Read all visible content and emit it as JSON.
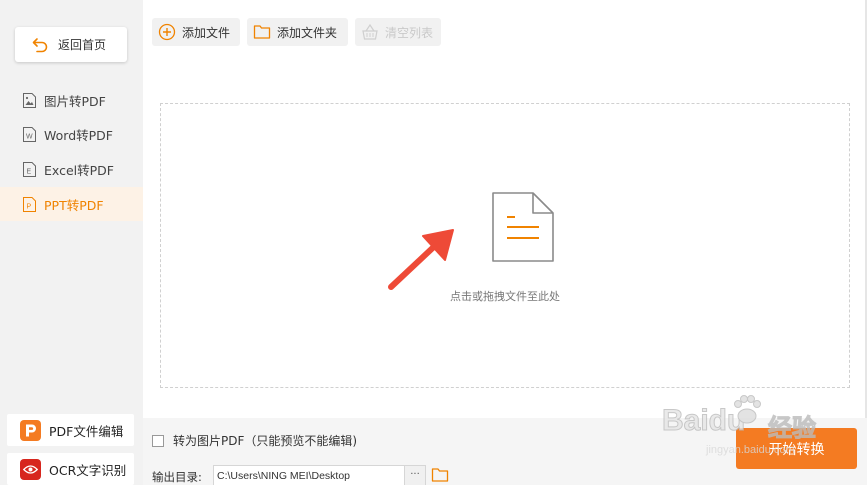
{
  "sidebar": {
    "back_label": "返回首页",
    "items": [
      {
        "label": "图片转PDF",
        "icon": "image-file-icon"
      },
      {
        "label": "Word转PDF",
        "icon": "word-file-icon"
      },
      {
        "label": "Excel转PDF",
        "icon": "excel-file-icon"
      },
      {
        "label": "PPT转PDF",
        "icon": "ppt-file-icon",
        "active": true
      }
    ],
    "tools": [
      {
        "label": "PDF文件编辑",
        "icon": "pdf-edit-icon",
        "color": "#f47b22"
      },
      {
        "label": "OCR文字识别",
        "icon": "ocr-eye-icon",
        "color": "#d7261e"
      }
    ]
  },
  "toolbar": {
    "add_file": "添加文件",
    "add_folder": "添加文件夹",
    "clear_list": "清空列表"
  },
  "dropzone": {
    "hint": "点击或拖拽文件至此处"
  },
  "bottom": {
    "to_image_pdf": "转为图片PDF（只能预览不能编辑)",
    "output_label": "输出目录:",
    "output_path": "C:\\Users\\NING MEI\\Desktop",
    "more_label": "···",
    "start_label": "开始转换"
  },
  "watermark": {
    "brand": "Baidu",
    "suffix": "经验",
    "url": "jingyan.baidu.com"
  },
  "colors": {
    "accent": "#f08300",
    "start_button": "#f47b22",
    "active_bg": "#fdf2e6",
    "arrow": "#ee4a37"
  }
}
